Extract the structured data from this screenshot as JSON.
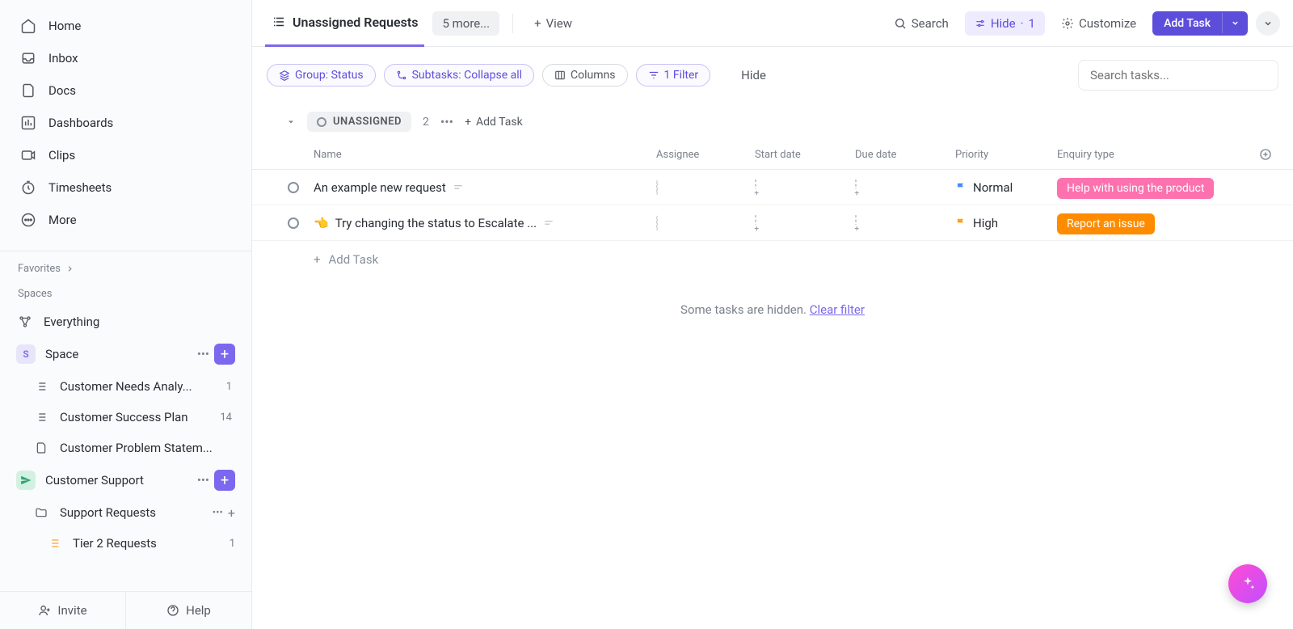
{
  "nav": {
    "home": "Home",
    "inbox": "Inbox",
    "docs": "Docs",
    "dashboards": "Dashboards",
    "clips": "Clips",
    "timesheets": "Timesheets",
    "more": "More"
  },
  "sections": {
    "favorites": "Favorites",
    "spaces": "Spaces"
  },
  "everything": "Everything",
  "space1": {
    "initial": "S",
    "name": "Space",
    "items": [
      {
        "label": "Customer Needs Analy...",
        "count": "1"
      },
      {
        "label": "Customer Success Plan",
        "count": "14"
      },
      {
        "label": "Customer Problem Statem..."
      }
    ]
  },
  "space2": {
    "name": "Customer Support",
    "items": [
      {
        "label": "Support Requests"
      },
      {
        "label": "Tier 2 Requests",
        "count": "1"
      }
    ]
  },
  "footer": {
    "invite": "Invite",
    "help": "Help"
  },
  "header": {
    "active_tab": "Unassigned Requests",
    "more": "5 more...",
    "view": "View",
    "search": "Search",
    "hide": "Hide",
    "hide_count": "1",
    "customize": "Customize",
    "add_task": "Add Task"
  },
  "filters": {
    "group": "Group: Status",
    "subtasks": "Subtasks: Collapse all",
    "columns": "Columns",
    "filter": "1 Filter",
    "hide": "Hide",
    "search_placeholder": "Search tasks..."
  },
  "group": {
    "status": "UNASSIGNED",
    "count": "2",
    "add_task": "Add Task"
  },
  "columns": {
    "name": "Name",
    "assignee": "Assignee",
    "start_date": "Start date",
    "due_date": "Due date",
    "priority": "Priority",
    "enquiry_type": "Enquiry type"
  },
  "tasks": [
    {
      "name": "An example new request",
      "priority": "Normal",
      "priority_color": "#4a88ff",
      "tag": "Help with using the product",
      "tag_class": "tag-pink",
      "emoji": ""
    },
    {
      "name": "Try changing the status to Escalate ...",
      "priority": "High",
      "priority_color": "#ff9f1a",
      "tag": "Report an issue",
      "tag_class": "tag-orange",
      "emoji": "👈"
    }
  ],
  "add_row": "Add Task",
  "hidden": {
    "text": "Some tasks are hidden. ",
    "link": "Clear filter"
  }
}
